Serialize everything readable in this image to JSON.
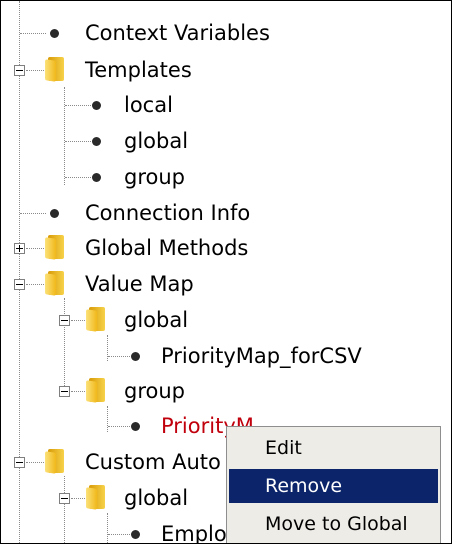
{
  "tree": {
    "items": [
      {
        "label": "Context Variables",
        "type": "leaf"
      },
      {
        "label": "Templates",
        "type": "folder",
        "expanded": true
      },
      {
        "label": "local",
        "type": "leaf"
      },
      {
        "label": "global",
        "type": "leaf"
      },
      {
        "label": "group",
        "type": "leaf"
      },
      {
        "label": "Connection Info",
        "type": "leaf"
      },
      {
        "label": "Global Methods",
        "type": "folder",
        "expanded": false
      },
      {
        "label": "Value Map",
        "type": "folder",
        "expanded": true
      },
      {
        "label": "global",
        "type": "folder",
        "expanded": true
      },
      {
        "label": "PriorityMap_forCSV",
        "type": "leaf"
      },
      {
        "label": "group",
        "type": "folder",
        "expanded": true
      },
      {
        "label": "PriorityM",
        "type": "leaf",
        "selected": true
      },
      {
        "label": "Custom Auto",
        "type": "folder",
        "expanded": true
      },
      {
        "label": "global",
        "type": "folder",
        "expanded": true
      },
      {
        "label": "Emplo",
        "type": "leaf"
      }
    ]
  },
  "context_menu": {
    "items": [
      {
        "label": "Edit"
      },
      {
        "label": "Remove",
        "highlighted": true
      },
      {
        "label": "Move to Global"
      }
    ]
  },
  "colors": {
    "selected_text": "#c0000c",
    "menu_highlight": "#0c246a",
    "menu_background": "#eeece6"
  },
  "icons": {
    "leaf": "bullet-icon",
    "folder": "folder-icon",
    "collapse": "collapse-minus-icon",
    "expand": "expand-plus-icon"
  }
}
